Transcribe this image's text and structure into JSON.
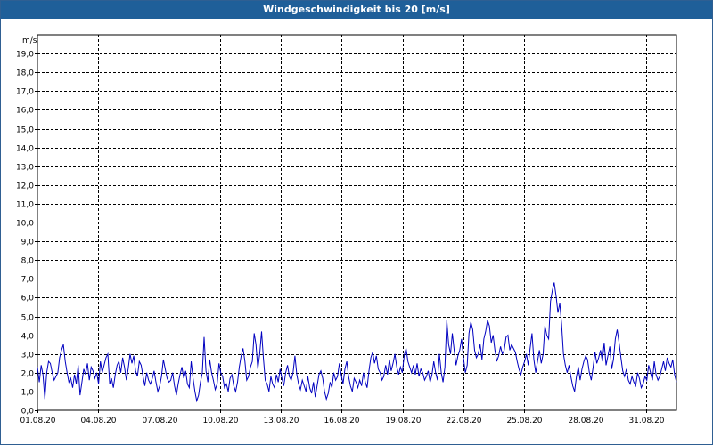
{
  "window": {
    "title": "Windgeschwindigkeit bis 20 [m/s]"
  },
  "chart_data": {
    "type": "line",
    "title": "Windgeschwindigkeit bis 20 [m/s]",
    "ylabel": "m/s",
    "xlabel": "",
    "ylim": [
      0,
      20
    ],
    "grid": true,
    "line_color": "#0000c0",
    "grid_color": "#000000",
    "y_ticks": [
      "0,0",
      "1,0",
      "2,0",
      "3,0",
      "4,0",
      "5,0",
      "6,0",
      "7,0",
      "8,0",
      "9,0",
      "10,0",
      "11,0",
      "12,0",
      "13,0",
      "14,0",
      "15,0",
      "16,0",
      "17,0",
      "18,0",
      "19,0"
    ],
    "x_ticks": [
      "01.08.20",
      "04.08.20",
      "07.08.20",
      "10.08.20",
      "13.08.20",
      "16.08.20",
      "19.08.20",
      "22.08.20",
      "25.08.20",
      "28.08.20",
      "31.08.20"
    ],
    "x_tick_days": [
      0,
      3,
      6,
      9,
      12,
      15,
      18,
      21,
      24,
      27,
      30
    ],
    "x_range_days": [
      0,
      31.5
    ],
    "series": [
      {
        "values": [
          2.3,
          1.5,
          2.4,
          1.9,
          0.6,
          2.0,
          2.6,
          2.5,
          2.0,
          1.6,
          1.8,
          2.0,
          2.8,
          3.2,
          3.5,
          2.6,
          2.0,
          1.5,
          1.7,
          1.2,
          1.9,
          1.4,
          2.4,
          0.8,
          1.5,
          2.2,
          1.9,
          2.5,
          1.6,
          2.3,
          2.1,
          1.7,
          2.0,
          1.4,
          2.6,
          2.0,
          2.4,
          2.8,
          3.0,
          1.4,
          1.7,
          1.2,
          1.9,
          2.4,
          2.6,
          2.0,
          2.8,
          2.3,
          1.6,
          2.2,
          3.0,
          2.5,
          2.9,
          2.1,
          1.8,
          2.6,
          2.4,
          1.8,
          1.3,
          2.0,
          1.6,
          1.4,
          1.7,
          2.1,
          1.5,
          1.0,
          1.3,
          1.8,
          2.7,
          2.2,
          1.7,
          1.5,
          1.6,
          2.0,
          1.3,
          0.8,
          1.4,
          1.9,
          2.3,
          1.7,
          2.1,
          1.4,
          1.2,
          2.6,
          1.7,
          1.0,
          0.5,
          0.8,
          1.5,
          2.0,
          3.9,
          2.1,
          1.5,
          2.7,
          2.0,
          1.6,
          1.1,
          1.4,
          2.5,
          2.0,
          1.8,
          1.2,
          1.4,
          1.0,
          1.7,
          1.9,
          1.3,
          1.0,
          1.5,
          2.3,
          2.9,
          3.3,
          2.6,
          1.6,
          1.8,
          2.3,
          2.6,
          4.1,
          3.5,
          2.2,
          3.0,
          4.2,
          2.8,
          1.6,
          1.4,
          1.0,
          1.8,
          1.4,
          1.2,
          1.9,
          1.5,
          2.2,
          1.7,
          1.3,
          2.0,
          2.4,
          1.8,
          1.6,
          2.0,
          2.9,
          1.9,
          1.4,
          1.1,
          1.6,
          1.3,
          1.0,
          1.8,
          1.2,
          0.9,
          1.5,
          0.7,
          1.3,
          1.9,
          2.1,
          1.7,
          1.0,
          0.6,
          0.9,
          1.5,
          1.2,
          2.0,
          1.6,
          1.8,
          2.5,
          1.9,
          1.4,
          2.2,
          2.6,
          1.8,
          1.3,
          1.0,
          1.7,
          1.5,
          1.2,
          1.6,
          1.3,
          2.0,
          1.5,
          1.2,
          2.1,
          2.8,
          3.1,
          2.5,
          2.9,
          2.2,
          2.0,
          1.6,
          1.8,
          2.4,
          1.9,
          2.7,
          2.1,
          2.5,
          3.0,
          2.3,
          1.9,
          2.3,
          2.0,
          2.9,
          3.3,
          2.6,
          2.3,
          2.0,
          2.4,
          1.9,
          2.5,
          1.8,
          2.2,
          2.0,
          1.6,
          1.8,
          2.1,
          1.5,
          1.9,
          2.6,
          2.0,
          1.6,
          3.0,
          2.0,
          1.5,
          2.3,
          4.8,
          3.5,
          3.0,
          4.1,
          3.2,
          2.4,
          2.9,
          3.2,
          3.8,
          2.8,
          2.0,
          2.4,
          4.1,
          4.7,
          4.3,
          3.2,
          2.8,
          3.0,
          3.5,
          2.7,
          3.8,
          4.2,
          4.8,
          4.5,
          3.6,
          4.0,
          3.2,
          2.6,
          2.9,
          3.4,
          3.0,
          3.2,
          3.9,
          4.0,
          3.2,
          3.5,
          3.3,
          3.1,
          2.6,
          2.2,
          1.9,
          2.3,
          2.6,
          3.0,
          2.4,
          3.3,
          4.1,
          2.7,
          2.0,
          2.6,
          3.2,
          2.5,
          3.0,
          4.5,
          4.0,
          3.8,
          5.8,
          6.4,
          6.8,
          6.1,
          5.2,
          5.7,
          4.6,
          3.0,
          2.4,
          2.0,
          2.4,
          1.8,
          1.3,
          1.0,
          1.8,
          2.3,
          1.6,
          2.2,
          2.6,
          2.9,
          2.7,
          2.0,
          1.6,
          2.3,
          3.1,
          2.5,
          2.8,
          3.2,
          2.6,
          3.6,
          2.4,
          2.9,
          3.4,
          2.2,
          2.7,
          3.8,
          4.3,
          3.6,
          2.8,
          2.1,
          1.8,
          2.2,
          1.6,
          1.4,
          1.8,
          1.5,
          1.3,
          2.0,
          1.7,
          1.2,
          1.4,
          1.8,
          1.6,
          2.4,
          2.0,
          1.6,
          2.6,
          1.9,
          1.6,
          1.8,
          2.2,
          2.6,
          2.1,
          2.8,
          2.5,
          2.3,
          2.7,
          1.9,
          1.5
        ]
      }
    ]
  }
}
